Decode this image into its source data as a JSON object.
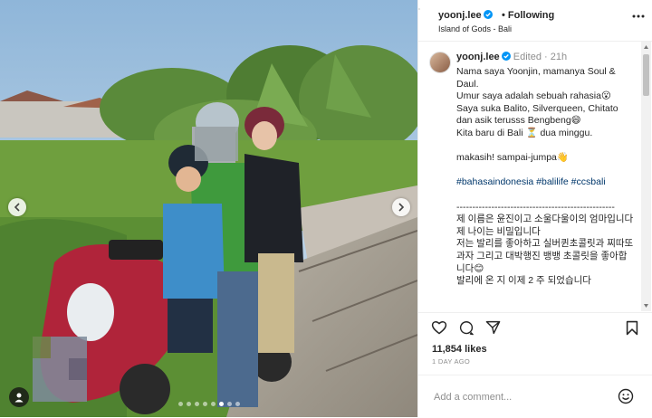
{
  "header": {
    "username": "yoonj.lee",
    "following_label": "Following",
    "location": "Island of Gods - Bali"
  },
  "caption": {
    "username": "yoonj.lee",
    "edited_label": "Edited",
    "separator": "·",
    "time": "21h",
    "lines": [
      "Nama saya Yoonjin, mamanya Soul & Daul.",
      "Umur saya adalah sebuah rahasia😮",
      "Saya suka Balito, Silverqueen, Chitato dan asik terusss Bengbeng😄",
      "Kita baru di Bali ⏳ dua minggu.",
      "makasih! sampai-jumpa👋",
      "#bahasaindonesia #balilife #ccsbali",
      "--------------------------------------------------",
      "제 이름은 윤진이고 소울다울이의 엄마입니다",
      "제 나이는 비밀입니다",
      "저는 발리를 좋아하고 실버퀸초콜릿과 찌따또 과자 그리고 대박행진 뱅뱅 초콜릿을 좋아합니다😊",
      "발리에 온 지 이제 2 주 되었습니다"
    ]
  },
  "stats": {
    "likes": "11,854 likes",
    "posted_ago": "1 DAY AGO"
  },
  "comment": {
    "placeholder": "Add a comment..."
  },
  "carousel": {
    "slide_count": 8,
    "active_index": 5
  }
}
